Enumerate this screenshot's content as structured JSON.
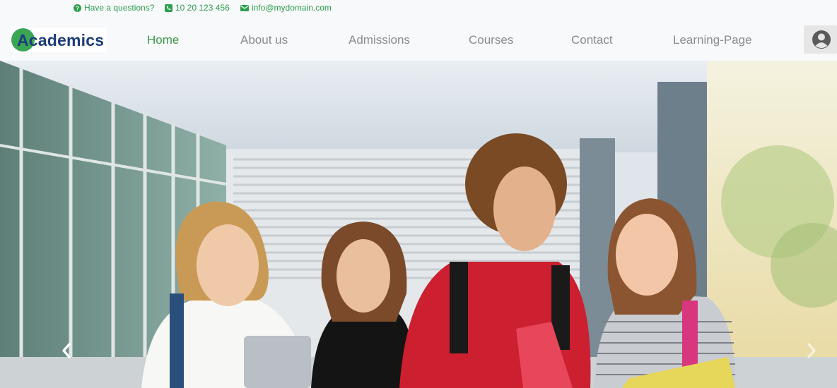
{
  "topbar": {
    "question": "Have a questions?",
    "phone": "10 20 123 456",
    "email": "info@mydomain.com"
  },
  "brand": {
    "logo_text": "Academics"
  },
  "nav": {
    "items": [
      {
        "label": "Home",
        "active": true
      },
      {
        "label": "About us",
        "active": false
      },
      {
        "label": "Admissions",
        "active": false
      },
      {
        "label": "Courses",
        "active": false
      },
      {
        "label": "Contact",
        "active": false
      },
      {
        "label": "Learning-Page",
        "active": false
      }
    ]
  },
  "user": {
    "icon": "user-circle-icon"
  },
  "hero": {
    "image": "students-walking-photo",
    "prev_icon": "chevron-left-icon",
    "next_icon": "chevron-right-icon"
  },
  "colors": {
    "accent": "#3a9a4a",
    "brand_green": "#3aa655",
    "brand_navy": "#1c3d7a",
    "nav_text": "#8a8a8a"
  }
}
